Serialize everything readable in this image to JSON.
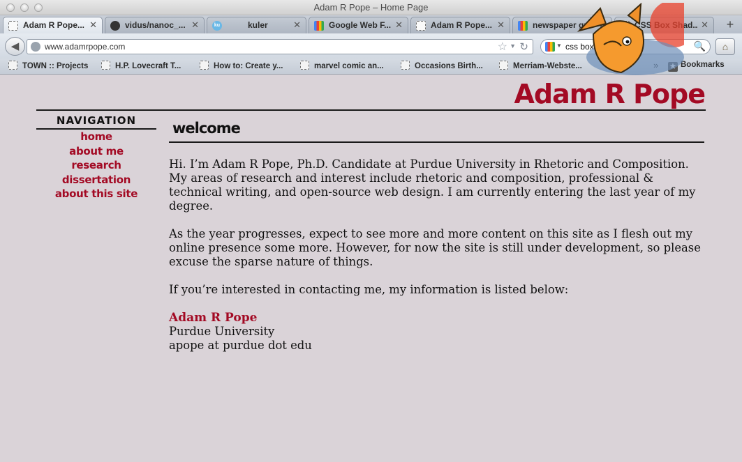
{
  "window": {
    "title": "Adam R Pope – Home Page"
  },
  "tabs": [
    {
      "label": "Adam R Pope...",
      "favicon": "page-icon",
      "active": true
    },
    {
      "label": "vidus/nanoc_...",
      "favicon": "github-icon",
      "active": false
    },
    {
      "label": "kuler",
      "favicon": "kuler-icon",
      "favicon_text": "ku",
      "active": false
    },
    {
      "label": "Google Web F...",
      "favicon": "google-icon",
      "active": false
    },
    {
      "label": "Adam R Pope...",
      "favicon": "page-icon",
      "active": false
    },
    {
      "label": "newspaper gr...",
      "favicon": "google-icon",
      "active": false
    },
    {
      "label": "CSS Box Shad...",
      "favicon": "page-icon",
      "active": false
    }
  ],
  "tab_close": "✕",
  "new_tab": "+",
  "toolbar": {
    "back": "◀",
    "url": "www.adamrpope.com",
    "star": "☆",
    "dropdown": "▼",
    "reload": "↻",
    "search_value": "css box shadow",
    "search_dropdown": "▼",
    "search_icon": "🔍",
    "home": "⌂"
  },
  "bookmarks": {
    "items": [
      {
        "label": "TOWN :: Projects"
      },
      {
        "label": "H.P. Lovecraft T..."
      },
      {
        "label": "How to: Create y..."
      },
      {
        "label": "marvel comic an..."
      },
      {
        "label": "Occasions Birth..."
      },
      {
        "label": "Merriam-Webste..."
      }
    ],
    "overflow": "»",
    "menu_label": "Bookmarks",
    "menu_icon": "★"
  },
  "colors": {
    "accent": "#a30a24",
    "background": "#dad3d8"
  },
  "site": {
    "title": "Adam R Pope",
    "nav_heading": "NAVIGATION",
    "nav": [
      {
        "label": "home"
      },
      {
        "label": "about me"
      },
      {
        "label": "research"
      },
      {
        "label": "dissertation"
      },
      {
        "label": "about this site"
      }
    ],
    "page_heading": "welcome",
    "paragraphs": [
      "Hi. I’m Adam R Pope, Ph.D. Candidate at Purdue University in Rhetoric and Composition. My areas of research and interest include rhetoric and composition, professional & technical writing, and open-source web design. I am currently entering the last year of my degree.",
      "As the year progresses, expect to see more and more content on this site as I flesh out my online presence some more. However, for now the site is still under development, so please excuse the sparse nature of things.",
      "If you’re interested in contacting me, my information is listed below:"
    ],
    "contact": {
      "name": "Adam R Pope",
      "org": "Purdue University",
      "email": "apope at purdue dot edu"
    }
  }
}
